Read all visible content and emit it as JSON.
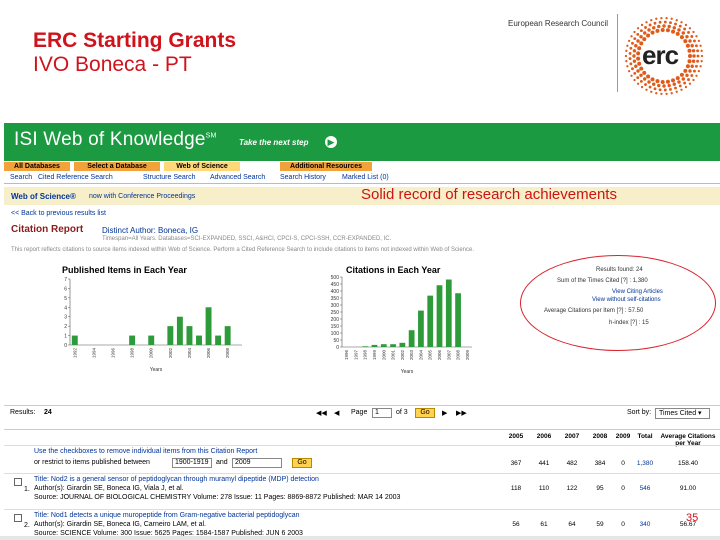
{
  "slide": {
    "title_line1": "ERC Starting Grants",
    "title_line2": "IVO Boneca - PT",
    "org_name": "European Research Council",
    "logo_text": "erc",
    "overlay": "Solid record of research achievements",
    "page_number": "35"
  },
  "isi": {
    "logo": "ISI Web of Knowledge",
    "logo_mark": "SM",
    "tagline": "Take the next step",
    "go_icon": "arrow-right-icon",
    "tabs": [
      "All Databases",
      "Select a Database",
      "Web of Science",
      "Additional Resources"
    ],
    "subnav": [
      "Search",
      "Cited Reference Search",
      "Structure Search",
      "Advanced Search",
      "Search History",
      "Marked List (0)"
    ],
    "wos_title": "Web of Science®",
    "wos_subtitle": "now with Conference Proceedings",
    "back_link": "<< Back to previous results list",
    "report_title": "Citation Report",
    "report_author": "Distinct Author: Boneca, IG",
    "timespan": "Timespan=All Years. Databases=SCI-EXPANDED, SSCI, A&HCI, CPCI-S, CPCI-SSH, CCR-EXPANDED, IC.",
    "note": "This report reflects citations to source items indexed within Web of Science. Perform a Cited Reference Search to include citations to items not indexed within Web of Science."
  },
  "stats": {
    "results_found_label": "Results found:",
    "results_found": "24",
    "sum_cited_label": "Sum of the Times Cited [?] :",
    "sum_cited": "1,380",
    "view_citing": "View Citing Articles",
    "view_no_self": "View without self-citations",
    "avg_label": "Average Citations per Item [?] :",
    "avg": "57.50",
    "h_index_label": "h-index [?] :",
    "h_index": "15"
  },
  "results_bar": {
    "results_label": "Results:",
    "results_value": "24",
    "page_label": "Page",
    "page_value": "1",
    "of_label": "of 3",
    "go_label": "Go",
    "sort_label": "Sort by:",
    "sort_value": "Times Cited"
  },
  "table": {
    "instruction": "Use the checkboxes to remove individual items from this Citation Report",
    "restrict_label": "or restrict to items published between",
    "year_from": "1900-1919",
    "and_label": "and",
    "year_to": "2009",
    "go_label": "Go",
    "headers": [
      "2005",
      "2006",
      "2007",
      "2008",
      "2009",
      "Total",
      "Average Citations per Year"
    ],
    "totals_row": [
      "367",
      "441",
      "482",
      "384",
      "0",
      "1,380",
      "158.40"
    ],
    "records": [
      {
        "num": "1.",
        "title": "Title: Nod2 is a general sensor of peptidoglycan through muramyl dipeptide (MDP) detection",
        "authors": "Author(s): Girardin SE, Boneca IG, Viala J, et al.",
        "source": "Source: JOURNAL OF BIOLOGICAL CHEMISTRY   Volume: 278   Issue: 11   Pages: 8869-8872   Published: MAR 14 2003",
        "values": [
          "118",
          "110",
          "122",
          "95",
          "0",
          "546",
          "91.00"
        ]
      },
      {
        "num": "2.",
        "title": "Title: Nod1 detects a unique muropeptide from Gram-negative bacterial peptidoglycan",
        "authors": "Author(s): Girardin SE, Boneca IG, Carneiro LAM, et al.",
        "source": "Source: SCIENCE   Volume: 300   Issue: 5625   Pages: 1584-1587   Published: JUN 6 2003",
        "values": [
          "56",
          "61",
          "64",
          "59",
          "0",
          "340",
          "56.67"
        ]
      }
    ]
  },
  "chart_data": [
    {
      "type": "bar",
      "title": "Published Items in Each Year",
      "xlabel": "Years",
      "categories": [
        "1992",
        "1993",
        "1994",
        "1995",
        "1996",
        "1997",
        "1998",
        "1999",
        "2000",
        "2001",
        "2002",
        "2003",
        "2004",
        "2005",
        "2006",
        "2007",
        "2008",
        "2009"
      ],
      "values": [
        1,
        0,
        0,
        0,
        0,
        0,
        1,
        0,
        1,
        0,
        2,
        3,
        2,
        1,
        4,
        1,
        2,
        0
      ],
      "ylim": [
        0,
        7
      ],
      "yticks": [
        0,
        1,
        2,
        3,
        4,
        5,
        6,
        7
      ],
      "xtick_labels": [
        "1992",
        "1994",
        "1996",
        "1998",
        "2000",
        "2002",
        "2004",
        "2006",
        "2008"
      ],
      "color": "#2e9b3a"
    },
    {
      "type": "bar",
      "title": "Citations in Each Year",
      "xlabel": "Years",
      "categories": [
        "1996",
        "1997",
        "1998",
        "1999",
        "2000",
        "2001",
        "2002",
        "2003",
        "2004",
        "2005",
        "2006",
        "2007",
        "2008",
        "2009"
      ],
      "values": [
        0,
        0,
        5,
        15,
        20,
        20,
        30,
        120,
        260,
        367,
        441,
        482,
        384,
        0
      ],
      "ylim": [
        0,
        500
      ],
      "yticks": [
        0,
        50,
        100,
        150,
        200,
        250,
        300,
        350,
        400,
        450,
        500
      ],
      "xtick_labels": [
        "1996",
        "1997",
        "1998",
        "1999",
        "2000",
        "2001",
        "2002",
        "2003",
        "2004",
        "2005",
        "2006",
        "2007",
        "2008",
        "2009"
      ],
      "color": "#2e9b3a"
    }
  ]
}
